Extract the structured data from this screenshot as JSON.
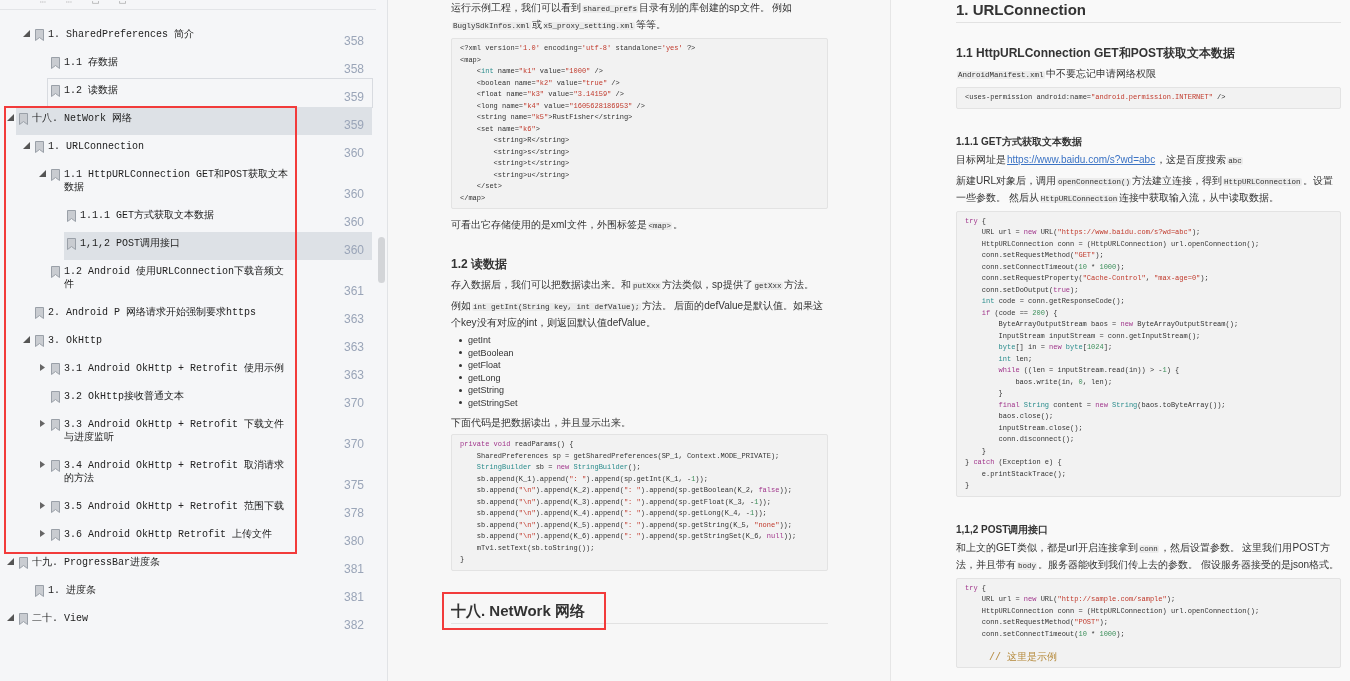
{
  "outline": {
    "continued": [
      {
        "label": "1. SharedPreferences 简介",
        "page": "358",
        "selected": false,
        "focused": false,
        "expanded": true,
        "children": [
          {
            "label": "1.1 存数据",
            "page": "358",
            "selected": false,
            "focused": false
          },
          {
            "label": "1.2 读数据",
            "page": "359",
            "selected": false,
            "focused": true
          }
        ]
      }
    ],
    "items": [
      {
        "label": "十八. NetWork 网络",
        "page": "359",
        "selected": true,
        "focused": false,
        "annotated": true,
        "expanded": true,
        "children": [
          {
            "label": "1. URLConnection",
            "page": "360",
            "selected": false,
            "focused": false,
            "expanded": true,
            "children": [
              {
                "label": "1.1 HttpURLConnection GET和POST获取文本数据",
                "page": "360",
                "selected": false,
                "focused": false,
                "expanded": true,
                "children": [
                  {
                    "label": "1.1.1 GET方式获取文本数据",
                    "page": "360",
                    "selected": false,
                    "focused": false
                  },
                  {
                    "label": "1,1,2 POST调用接口",
                    "page": "360",
                    "selected": true,
                    "focused": false
                  }
                ]
              },
              {
                "label": "1.2 Android 使用URLConnection下载音频文件",
                "page": "361",
                "selected": false,
                "focused": false
              }
            ]
          },
          {
            "label": "2. Android P 网络请求开始强制要求https",
            "page": "363",
            "selected": false,
            "focused": false
          },
          {
            "label": "3. OkHttp",
            "page": "363",
            "selected": false,
            "focused": false,
            "expanded": true,
            "children": [
              {
                "label": "3.1 Android OkHttp + Retrofit 使用示例",
                "page": "363",
                "selected": false,
                "focused": false,
                "expanded": false
              },
              {
                "label": "3.2 OkHttp接收普通文本",
                "page": "370",
                "selected": false,
                "focused": false
              },
              {
                "label": "3.3 Android OkHttp + Retrofit 下载文件与进度监听",
                "page": "370",
                "selected": false,
                "focused": false,
                "expanded": false
              },
              {
                "label": "3.4 Android OkHttp + Retrofit 取消请求的方法",
                "page": "375",
                "selected": false,
                "focused": false,
                "expanded": false
              },
              {
                "label": "3.5 Android OkHttp + Retrofit 范围下载",
                "page": "378",
                "selected": false,
                "focused": false,
                "expanded": false
              },
              {
                "label": "3.6 Android OkHttp Retrofit 上传文件",
                "page": "380",
                "selected": false,
                "focused": false,
                "expanded": false
              }
            ]
          }
        ]
      },
      {
        "label": "十九. ProgressBar进度条",
        "page": "381",
        "selected": false,
        "focused": false,
        "expanded": true,
        "children": [
          {
            "label": "1. 进度条",
            "page": "381",
            "selected": false,
            "focused": false
          }
        ]
      },
      {
        "label": "二十. View",
        "page": "382",
        "selected": false,
        "focused": false,
        "expanded": true
      }
    ]
  },
  "pages": [
    {
      "blocks": [
        {
          "kind": "paragraph",
          "segments": [
            {
              "kind": "text",
              "text": "运行示例工程，我们可以看到"
            },
            {
              "kind": "code",
              "text": "shared_prefs"
            },
            {
              "kind": "text",
              "text": "目录有别的库创建的sp文件。 例如"
            },
            {
              "kind": "code",
              "text": "BuglySdkInfos.xml"
            },
            {
              "kind": "text",
              "text": "或"
            },
            {
              "kind": "code",
              "text": "x5_proxy_setting.xml"
            },
            {
              "kind": "text",
              "text": "等等。"
            }
          ]
        },
        {
          "kind": "code",
          "lines": [
            "<?xml version='1.0' encoding='utf-8' standalone='yes' ?>",
            "<map>",
            "    <int name=\"k1\" value=\"1000\" />",
            "    <boolean name=\"k2\" value=\"true\" />",
            "    <float name=\"k3\" value=\"3.14159\" />",
            "    <long name=\"k4\" value=\"1605628186953\" />",
            "    <string name=\"k5\">RustFisher</string>",
            "    <set name=\"k6\">",
            "        <string>R</string>",
            "        <string>s</string>",
            "        <string>t</string>",
            "        <string>u</string>",
            "    </set>",
            "</map>"
          ]
        },
        {
          "kind": "paragraph",
          "segments": [
            {
              "kind": "text",
              "text": "可看出它存储使用的是xml文件，外围标签是"
            },
            {
              "kind": "code",
              "text": "<map>"
            },
            {
              "kind": "text",
              "text": "。"
            }
          ]
        },
        {
          "kind": "h2",
          "text": "1.2 读数据"
        },
        {
          "kind": "paragraph",
          "segments": [
            {
              "kind": "text",
              "text": "存入数据后，我们可以把数据读出来。和"
            },
            {
              "kind": "code",
              "text": "putXxx"
            },
            {
              "kind": "text",
              "text": "方法类似，sp提供了"
            },
            {
              "kind": "code",
              "text": "getXxx"
            },
            {
              "kind": "text",
              "text": "方法。"
            }
          ]
        },
        {
          "kind": "paragraph",
          "segments": [
            {
              "kind": "text",
              "text": "例如"
            },
            {
              "kind": "code",
              "text": "int getInt(String key, int defValue);"
            },
            {
              "kind": "text",
              "text": "方法。 后面的defValue是默认值。如果这个key没有对应的int，则返回默认值defValue。"
            }
          ]
        },
        {
          "kind": "list",
          "items": [
            "getInt",
            "getBoolean",
            "getFloat",
            "getLong",
            "getString",
            "getStringSet"
          ]
        },
        {
          "kind": "paragraph",
          "segments": [
            {
              "kind": "text",
              "text": "下面代码是把数据读出，并且显示出来。"
            }
          ]
        },
        {
          "kind": "code",
          "lines": [
            "private void readParams() {",
            "    SharedPreferences sp = getSharedPreferences(SP_1, Context.MODE_PRIVATE);",
            "    StringBuilder sb = new StringBuilder();",
            "    sb.append(K_1).append(\": \").append(sp.getInt(K_1, -1));",
            "    sb.append(\"\\n\").append(K_2).append(\": \").append(sp.getBoolean(K_2, false));",
            "    sb.append(\"\\n\").append(K_3).append(\": \").append(sp.getFloat(K_3, -1));",
            "    sb.append(\"\\n\").append(K_4).append(\": \").append(sp.getLong(K_4, -1));",
            "    sb.append(\"\\n\").append(K_5).append(\": \").append(sp.getString(K_5, \"none\"));",
            "    sb.append(\"\\n\").append(K_6).append(\": \").append(sp.getStringSet(K_6, null));",
            "    mTv1.setText(sb.toString());",
            "}"
          ]
        },
        {
          "kind": "h1",
          "text": "十八. NetWork 网络",
          "annotated": true
        }
      ]
    },
    {
      "blocks": [
        {
          "kind": "h1",
          "text": "1. URLConnection"
        },
        {
          "kind": "h2",
          "text": "1.1 HttpURLConnection GET和POST获取文本数据"
        },
        {
          "kind": "paragraph",
          "segments": [
            {
              "kind": "code",
              "text": "AndroidManifest.xml"
            },
            {
              "kind": "text",
              "text": "中不要忘记申请网络权限"
            }
          ]
        },
        {
          "kind": "code",
          "lines": [
            "<uses-permission android:name=\"android.permission.INTERNET\" />"
          ]
        },
        {
          "kind": "h3",
          "text": "1.1.1 GET方式获取文本数据"
        },
        {
          "kind": "paragraph",
          "segments": [
            {
              "kind": "text",
              "text": "目标网址是"
            },
            {
              "kind": "link",
              "text": "https://www.baidu.com/s?wd=abc"
            },
            {
              "kind": "text",
              "text": "，这是百度搜索"
            },
            {
              "kind": "code",
              "text": "abc"
            }
          ]
        },
        {
          "kind": "paragraph",
          "segments": [
            {
              "kind": "text",
              "text": "新建URL对象后，调用"
            },
            {
              "kind": "code",
              "text": "openConnection()"
            },
            {
              "kind": "text",
              "text": "方法建立连接，得到"
            },
            {
              "kind": "code",
              "text": "HttpURLConnection"
            },
            {
              "kind": "text",
              "text": "。设置一些参数。 然后从"
            },
            {
              "kind": "code",
              "text": "HttpURLConnection"
            },
            {
              "kind": "text",
              "text": "连接中获取输入流，从中读取数据。"
            }
          ]
        },
        {
          "kind": "code",
          "lines": [
            "try {",
            "    URL url = new URL(\"https://www.baidu.com/s?wd=abc\");",
            "    HttpURLConnection conn = (HttpURLConnection) url.openConnection();",
            "    conn.setRequestMethod(\"GET\");",
            "    conn.setConnectTimeout(10 * 1000);",
            "    conn.setRequestProperty(\"Cache-Control\", \"max-age=0\");",
            "    conn.setDoOutput(true);",
            "    int code = conn.getResponseCode();",
            "    if (code == 200) {",
            "        ByteArrayOutputStream baos = new ByteArrayOutputStream();",
            "        InputStream inputStream = conn.getInputStream();",
            "        byte[] in = new byte[1024];",
            "        int len;",
            "        while ((len = inputStream.read(in)) > -1) {",
            "            baos.write(in, 0, len);",
            "        }",
            "        final String content = new String(baos.toByteArray());",
            "        baos.close();",
            "        inputStream.close();",
            "        conn.disconnect();",
            "    }",
            "} catch (Exception e) {",
            "    e.printStackTrace();",
            "}"
          ]
        },
        {
          "kind": "h3",
          "text": "1,1,2 POST调用接口"
        },
        {
          "kind": "paragraph",
          "segments": [
            {
              "kind": "text",
              "text": "和上文的GET类似，都是url开启连接拿到"
            },
            {
              "kind": "code",
              "text": "conn"
            },
            {
              "kind": "text",
              "text": "，然后设置参数。 这里我们用POST方法，并且带有"
            },
            {
              "kind": "code",
              "text": "body"
            },
            {
              "kind": "text",
              "text": "。服务器能收到我们传上去的参数。 假设服务器接受的是json格式。"
            }
          ]
        },
        {
          "kind": "code",
          "lines": [
            "try {",
            "    URL url = new URL(\"http://sample.com/sample\");",
            "    HttpURLConnection conn = (HttpURLConnection) url.openConnection();",
            "    conn.setRequestMethod(\"POST\");",
            "    conn.setConnectTimeout(10 * 1000);",
            {
              "text": "    // 这里是示例",
              "kind": "comment",
              "blank_before": true
            }
          ]
        }
      ]
    }
  ]
}
